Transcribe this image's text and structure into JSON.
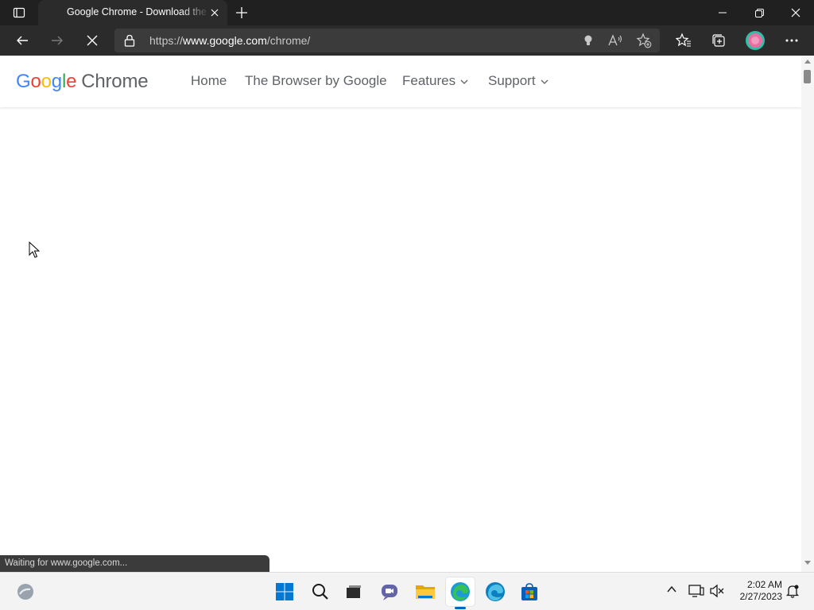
{
  "browser": {
    "tab": {
      "title": "Google Chrome - Download the Fast, Secure Browser from Google"
    },
    "address": {
      "scheme": "https://",
      "host": "www.google.com",
      "path": "/chrome/"
    },
    "status_text": "Waiting for www.google.com..."
  },
  "site": {
    "logo": {
      "google_letters": [
        "G",
        "o",
        "o",
        "g",
        "l",
        "e"
      ],
      "google_colors": [
        "#4285F4",
        "#EA4335",
        "#FBBC05",
        "#4285F4",
        "#34A853",
        "#EA4335"
      ],
      "product": "Chrome"
    },
    "nav": [
      {
        "label": "Home"
      },
      {
        "label": "The Browser by Google"
      },
      {
        "label": "Features"
      },
      {
        "label": "Support"
      }
    ]
  },
  "taskbar": {
    "apps": [
      "widgets-icon",
      "start-icon",
      "search-icon",
      "task-view-icon",
      "chat-icon",
      "file-explorer-icon",
      "edge-icon",
      "edge-beta-icon",
      "store-icon"
    ],
    "clock": {
      "time": "2:02 AM",
      "date": "2/27/2023"
    }
  },
  "colors": {
    "accent": "#0067c0",
    "titlebar": "#202020",
    "toolbar": "#2b2b2b"
  }
}
